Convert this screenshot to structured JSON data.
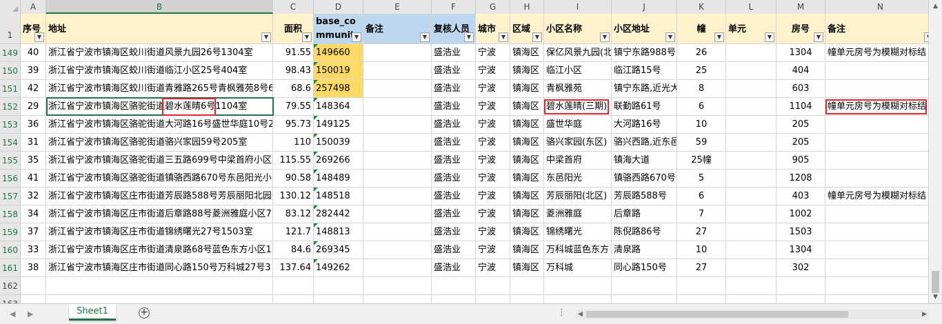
{
  "column_letters": [
    "A",
    "B",
    "C",
    "D",
    "E",
    "F",
    "G",
    "H",
    "I",
    "J",
    "K",
    "L",
    "M",
    "N"
  ],
  "selected_column": "B",
  "header_row": {
    "row_label": "1",
    "cells": [
      "序号",
      "地址",
      "面积",
      "base_community_",
      "备注",
      "复核人员",
      "城市",
      "区域",
      "小区名称",
      "小区地址",
      "幢",
      "单元",
      "房号",
      "备注"
    ]
  },
  "rows": [
    {
      "label": "149",
      "cells": [
        "40",
        "浙江省宁波市镇海区蛟川街道风景九园26号1304室",
        "91.55",
        "149660",
        "",
        "盛浩业",
        "宁波",
        "镇海区",
        "保亿风景九园(北",
        "镇宁东路988号",
        "26",
        "",
        "1304",
        "幢单元房号为模糊对标结"
      ]
    },
    {
      "label": "150",
      "cells": [
        "39",
        "浙江省宁波市镇海区蛟川街道临江小区25号404室",
        "98.43",
        "150019",
        "",
        "盛浩业",
        "宁波",
        "镇海区",
        "临江小区",
        "临江路15号",
        "25",
        "",
        "404",
        ""
      ]
    },
    {
      "label": "151",
      "cells": [
        "42",
        "浙江省宁波市镇海区蛟川街道青雅路265号青枫雅苑8号6",
        "68.6",
        "257498",
        "",
        "盛浩业",
        "宁波",
        "镇海区",
        "青枫雅苑",
        "镇宁东路,近光大",
        "8",
        "",
        "603",
        ""
      ]
    },
    {
      "label": "152",
      "cells": [
        "29",
        "浙江省宁波市镇海区骆驼街道碧水莲晴6号1104室",
        "79.55",
        "148364",
        "",
        "盛浩业",
        "宁波",
        "镇海区",
        "碧水莲晴(三期)",
        "联勤路61号",
        "6",
        "",
        "1104",
        "幢单元房号为模糊对标结"
      ]
    },
    {
      "label": "153",
      "cells": [
        "36",
        "浙江省宁波市镇海区骆驼街道大河路16号盛世华庭10号2",
        "95.73",
        "149125",
        "",
        "盛浩业",
        "宁波",
        "镇海区",
        "盛世华庭",
        "大河路16号",
        "10",
        "",
        "205",
        ""
      ]
    },
    {
      "label": "154",
      "cells": [
        "31",
        "浙江省宁波市镇海区骆驼街道骆兴家园59号205室",
        "110",
        "150039",
        "",
        "盛浩业",
        "宁波",
        "镇海区",
        "骆兴家园(东区)",
        "骆兴西路,近东邑",
        "59",
        "",
        "205",
        ""
      ]
    },
    {
      "label": "155",
      "cells": [
        "35",
        "浙江省宁波市镇海区骆驼街道三五路699号中梁首府小区2",
        "115.55",
        "269266",
        "",
        "盛浩业",
        "宁波",
        "镇海区",
        "中梁首府",
        "镇海大道",
        "25幢",
        "",
        "905",
        ""
      ]
    },
    {
      "label": "156",
      "cells": [
        "41",
        "浙江省宁波市镇海区骆驼街道镇骆西路670号东邑阳光小",
        "90.58",
        "148489",
        "",
        "盛浩业",
        "宁波",
        "镇海区",
        "东邑阳光",
        "镇骆西路670号",
        "5",
        "",
        "1208",
        ""
      ]
    },
    {
      "label": "157",
      "cells": [
        "32",
        "浙江省宁波市镇海区庄市街道芳辰路588号芳辰丽阳北园6",
        "130.12",
        "148518",
        "",
        "盛浩业",
        "宁波",
        "镇海区",
        "芳辰丽阳(北区)",
        "芳辰路588号",
        "6",
        "",
        "403",
        "幢单元房号为模糊对标结"
      ]
    },
    {
      "label": "158",
      "cells": [
        "34",
        "浙江省宁波市镇海区庄市街道后章路88号菱洲雅庭小区7",
        "83.12",
        "282442",
        "",
        "盛浩业",
        "宁波",
        "镇海区",
        "菱洲雅庭",
        "后章路",
        "7",
        "",
        "1002",
        ""
      ]
    },
    {
      "label": "159",
      "cells": [
        "37",
        "浙江省宁波市镇海区庄市街道锦绣曙光27号1503室",
        "121.7",
        "148813",
        "",
        "盛浩业",
        "宁波",
        "镇海区",
        "锦绣曙光",
        "陈倪路86号",
        "27",
        "",
        "1503",
        ""
      ]
    },
    {
      "label": "160",
      "cells": [
        "33",
        "浙江省宁波市镇海区庄市街道清泉路68号蓝色东方小区1",
        "84.6",
        "269345",
        "",
        "盛浩业",
        "宁波",
        "镇海区",
        "万科城蓝色东方",
        "清泉路",
        "10",
        "",
        "1304",
        ""
      ]
    },
    {
      "label": "161",
      "cells": [
        "38",
        "浙江省宁波市镇海区庄市街道同心路150号万科城27号3",
        "137.64",
        "149262",
        "",
        "盛浩业",
        "宁波",
        "镇海区",
        "万科城",
        "同心路150号",
        "27",
        "",
        "302",
        ""
      ]
    },
    {
      "label": "162",
      "cells": [
        "",
        "",
        "",
        "",
        "",
        "",
        "",
        "",
        "",
        "",
        "",
        "",
        "",
        ""
      ]
    },
    {
      "label": "163",
      "cells": [
        "",
        "",
        "",
        "",
        "",
        "",
        "",
        "",
        "",
        "",
        "",
        "",
        "",
        ""
      ]
    }
  ],
  "sheet_tabs": [
    "Sheet1"
  ],
  "add_sheet_label": "+",
  "colors": {
    "accent": "#217346",
    "highlight_yellow": "#ffd966",
    "header_blue": "#bdd7ee",
    "header_yellow": "#fff2cc",
    "annotation_red": "#e0252e"
  }
}
